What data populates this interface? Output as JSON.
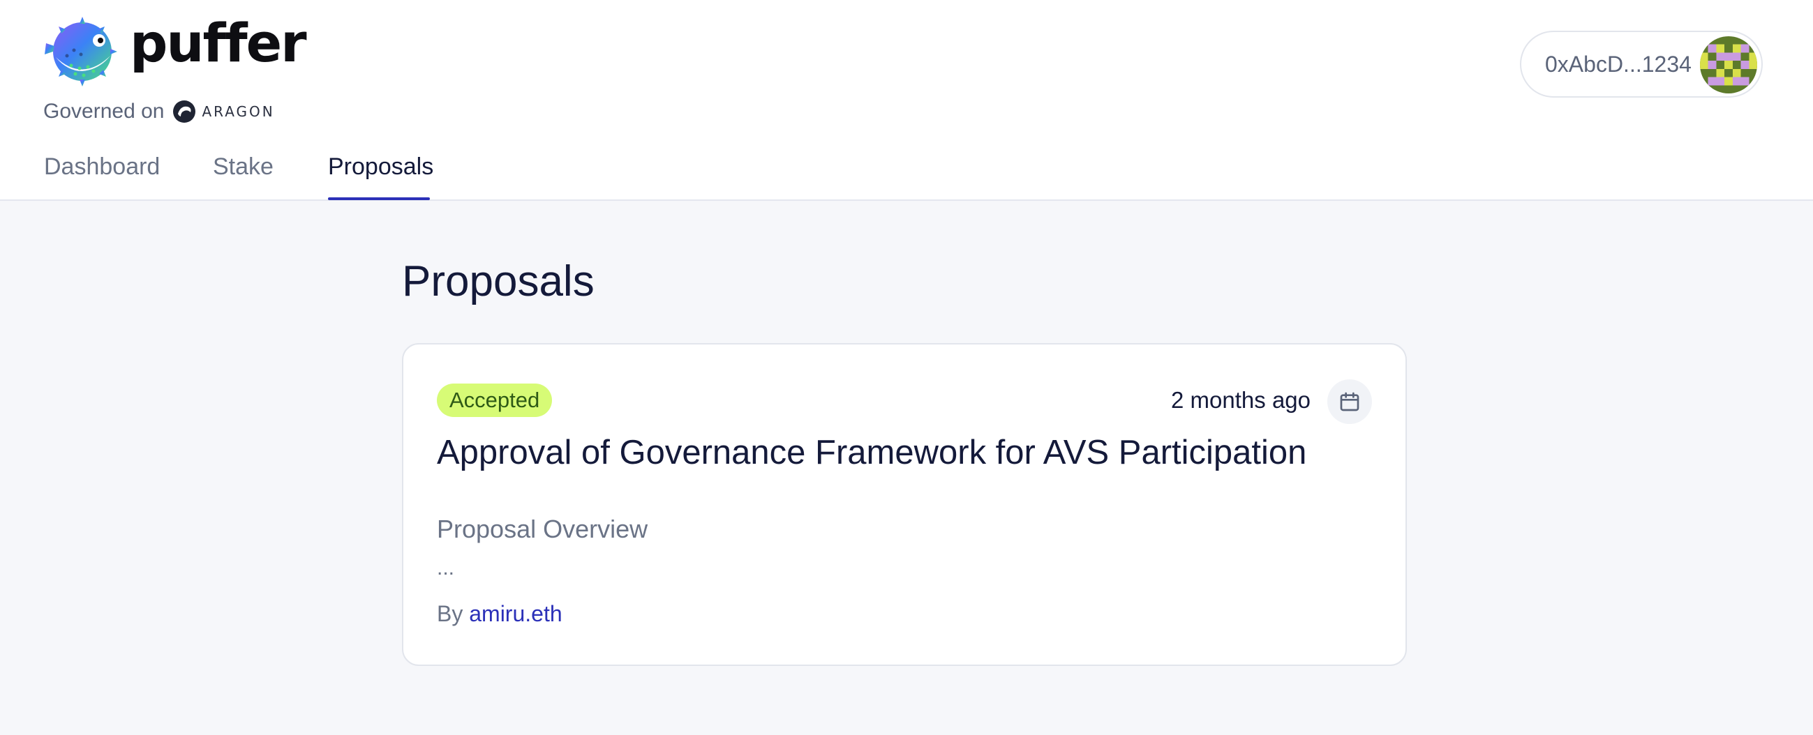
{
  "brand": {
    "name": "puffer",
    "governed_prefix": "Governed on",
    "platform_name": "ARAGON",
    "logo_icon": "pufferfish-logo-icon",
    "platform_icon": "aragon-logo-icon"
  },
  "nav": {
    "tabs": [
      {
        "label": "Dashboard",
        "active": false
      },
      {
        "label": "Stake",
        "active": false
      },
      {
        "label": "Proposals",
        "active": true
      }
    ]
  },
  "wallet": {
    "address": "0xAbcD...1234",
    "avatar_icon": "identicon-avatar"
  },
  "page": {
    "title": "Proposals"
  },
  "proposal": {
    "status": "Accepted",
    "time_ago": "2 months ago",
    "title": "Approval of Governance Framework for AVS Participation",
    "overview_heading": "Proposal Overview",
    "excerpt": "...",
    "by_label": "By",
    "author": "amiru.eth",
    "calendar_icon": "calendar-icon"
  },
  "colors": {
    "accent": "#2b30b8",
    "badge_bg": "#d7fb76",
    "badge_text": "#2e5a16",
    "page_bg": "#f6f7fa",
    "text_primary": "#141a3a",
    "text_muted": "#6a7386"
  }
}
